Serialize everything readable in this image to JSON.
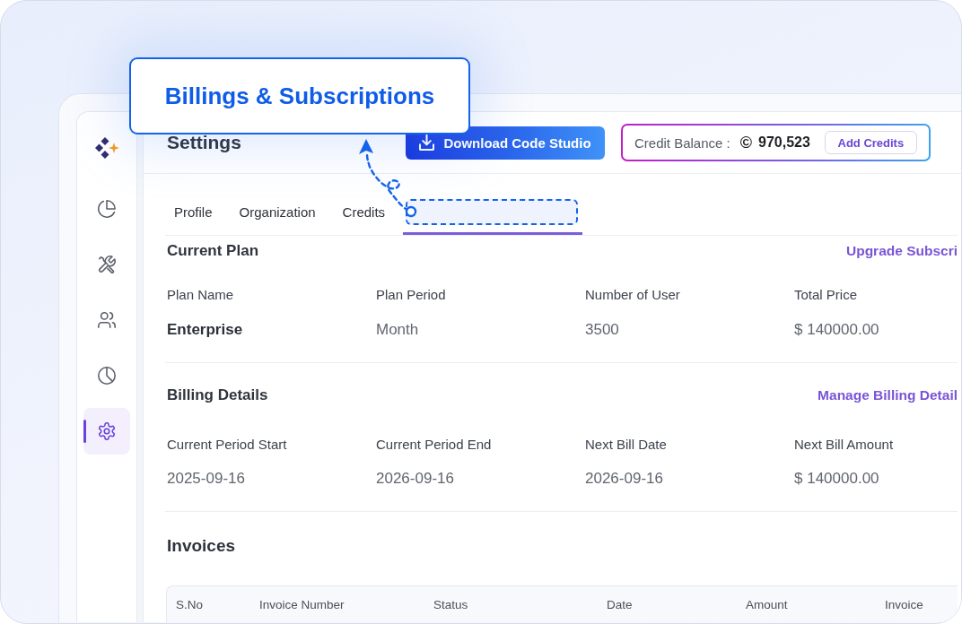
{
  "annotation": {
    "label": "Billings & Subscriptions"
  },
  "sidebar": {
    "items": [
      {
        "selected": false
      },
      {
        "selected": false
      },
      {
        "selected": false
      },
      {
        "selected": false
      },
      {
        "selected": true
      }
    ]
  },
  "header": {
    "title": "Settings",
    "download_button": "Download Code Studio",
    "credit_balance": {
      "label": "Credit Balance :",
      "symbol": "©",
      "amount": "970,523",
      "button": "Add Credits"
    }
  },
  "tabs": [
    {
      "label": "Profile",
      "selected": false,
      "highlighted": false
    },
    {
      "label": "Organization",
      "selected": false,
      "highlighted": false
    },
    {
      "label": "Credits",
      "selected": false,
      "highlighted": false
    },
    {
      "selected": true,
      "highlighted": true
    }
  ],
  "sections": [
    {
      "title": "Current Plan",
      "link": "Upgrade Subscri",
      "fields": [
        {
          "label": "Plan Name",
          "value": "Enterprise",
          "emphasized": true
        },
        {
          "label": "Plan Period",
          "value": "Month",
          "emphasized": false
        },
        {
          "label": "Number of User",
          "value": "3500",
          "emphasized": false
        },
        {
          "label": "Total Price",
          "value": "$ 140000.00",
          "emphasized": false
        }
      ]
    },
    {
      "title": "Billing Details",
      "link": "Manage Billing Detail",
      "fields": [
        {
          "label": "Current Period Start",
          "value": "2025-09-16",
          "emphasized": false
        },
        {
          "label": "Current Period End",
          "value": "2026-09-16",
          "emphasized": false
        },
        {
          "label": "Next Bill Date",
          "value": "2026-09-16",
          "emphasized": false
        },
        {
          "label": "Next Bill Amount",
          "value": "$ 140000.00",
          "emphasized": false
        }
      ]
    }
  ],
  "invoices": {
    "title": "Invoices",
    "table": {
      "columns": [
        "S.No",
        "Invoice Number",
        "Status",
        "Date",
        "Amount",
        "Invoice"
      ]
    }
  }
}
